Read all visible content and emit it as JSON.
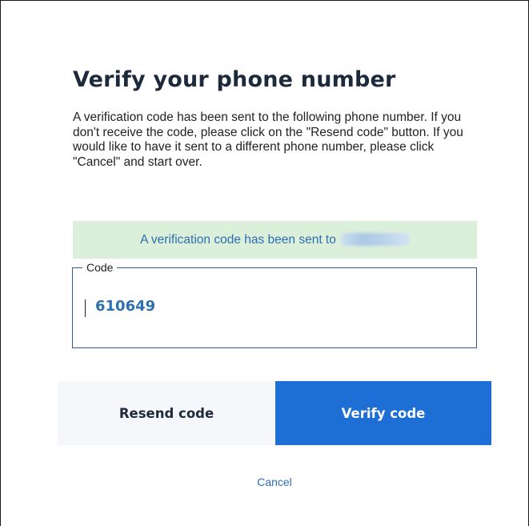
{
  "dialog": {
    "title": "Verify your phone number",
    "description": "A verification code has been sent to the following phone number. If you don't receive the code, please click on the \"Resend code\" button. If you would like to have it sent to a different phone number, please click \"Cancel\" and start over."
  },
  "notice": {
    "text": "A verification code has been sent to"
  },
  "code_field": {
    "label": "Code",
    "value": "610649"
  },
  "buttons": {
    "resend_label": "Resend code",
    "verify_label": "Verify code",
    "cancel_label": "Cancel"
  },
  "colors": {
    "title": "#1d2a3c",
    "accent": "#1d6fd6",
    "link": "#2d6fb0",
    "notice_bg": "#dcefdb",
    "field_border": "#2e5d8e",
    "secondary_button_bg": "#f5f7fa"
  }
}
